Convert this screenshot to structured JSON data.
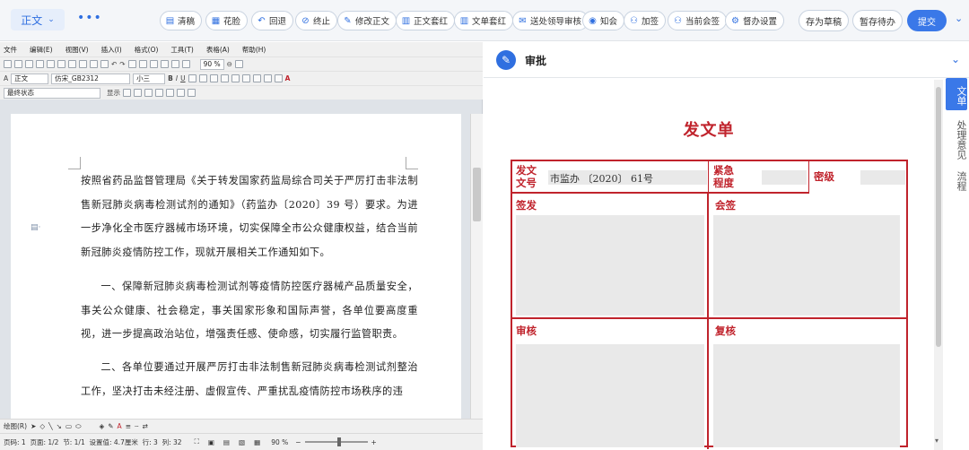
{
  "topbar": {
    "doc_tab": "正文",
    "buttons": [
      {
        "label": "清稿",
        "icon": "clean-icon"
      },
      {
        "label": "花脸",
        "icon": "track-icon"
      },
      {
        "label": "回退",
        "icon": "undo-icon"
      },
      {
        "label": "终止",
        "icon": "stop-icon"
      },
      {
        "label": "修改正文",
        "icon": "edit-icon"
      },
      {
        "label": "正文套红",
        "icon": "template-icon"
      },
      {
        "label": "文单套红",
        "icon": "template-icon"
      },
      {
        "label": "送处领导审核",
        "icon": "send-icon"
      },
      {
        "label": "知会",
        "icon": "notify-icon"
      },
      {
        "label": "加签",
        "icon": "add-sign-icon"
      },
      {
        "label": "当前会签",
        "icon": "cosign-icon"
      },
      {
        "label": "督办设置",
        "icon": "gear-icon"
      }
    ],
    "save_draft": "存为草稿",
    "save_pending": "暂存待办",
    "submit": "提交"
  },
  "editor": {
    "menu": [
      "文件",
      "编辑(E)",
      "视图(V)",
      "插入(I)",
      "格式(O)",
      "工具(T)",
      "表格(A)",
      "帮助(H)"
    ],
    "zoom": "90 %",
    "style": "正文",
    "font": "仿宋_GB2312",
    "size": "小三",
    "track_state": "最终状态",
    "show_label": "显示",
    "draw_label": "绘图(R)",
    "paragraphs": [
      "按照省药品监督管理局《关于转发国家药监局综合司关于严厉打击非法制售新冠肺炎病毒检测试剂的通知》（药监办〔2020〕39 号）要求。为进一步净化全市医疗器械市场环境，切实保障全市公众健康权益，结合当前新冠肺炎疫情防控工作，现就开展相关工作通知如下。",
      "一、保障新冠肺炎病毒检测试剂等疫情防控医疗器械产品质量安全，事关公众健康、社会稳定，事关国家形象和国际声誉，各单位要高度重视，进一步提高政治站位，增强责任感、使命感，切实履行监管职责。",
      "二、各单位要通过开展严厉打击非法制售新冠肺炎病毒检测试剂整治工作，坚决打击未经注册、虚假宣传、严重扰乱疫情防控市场秩序的违"
    ],
    "status": {
      "page": "页码: 1",
      "pages": "页面: 1/2",
      "section": "节: 1/1",
      "setting": "设置值: 4.7厘米",
      "row": "行: 3",
      "col": "列: 32",
      "zoom": "90 %"
    }
  },
  "approval": {
    "header": "审批",
    "side_tabs": [
      "文单",
      "处理意见",
      "流程"
    ],
    "form_title": "发文单",
    "fields": {
      "doc_no_label": "发文\n文号",
      "doc_no_value": "市监办 〔2020〕 61号",
      "urgency_label": "紧急\n程度",
      "secret_label": "密级",
      "sign_label": "签发",
      "cosign_label": "会签",
      "review_label": "审核",
      "recheck_label": "复核"
    }
  },
  "colors": {
    "accent": "#3a78e8",
    "form_red": "#c0232c"
  }
}
